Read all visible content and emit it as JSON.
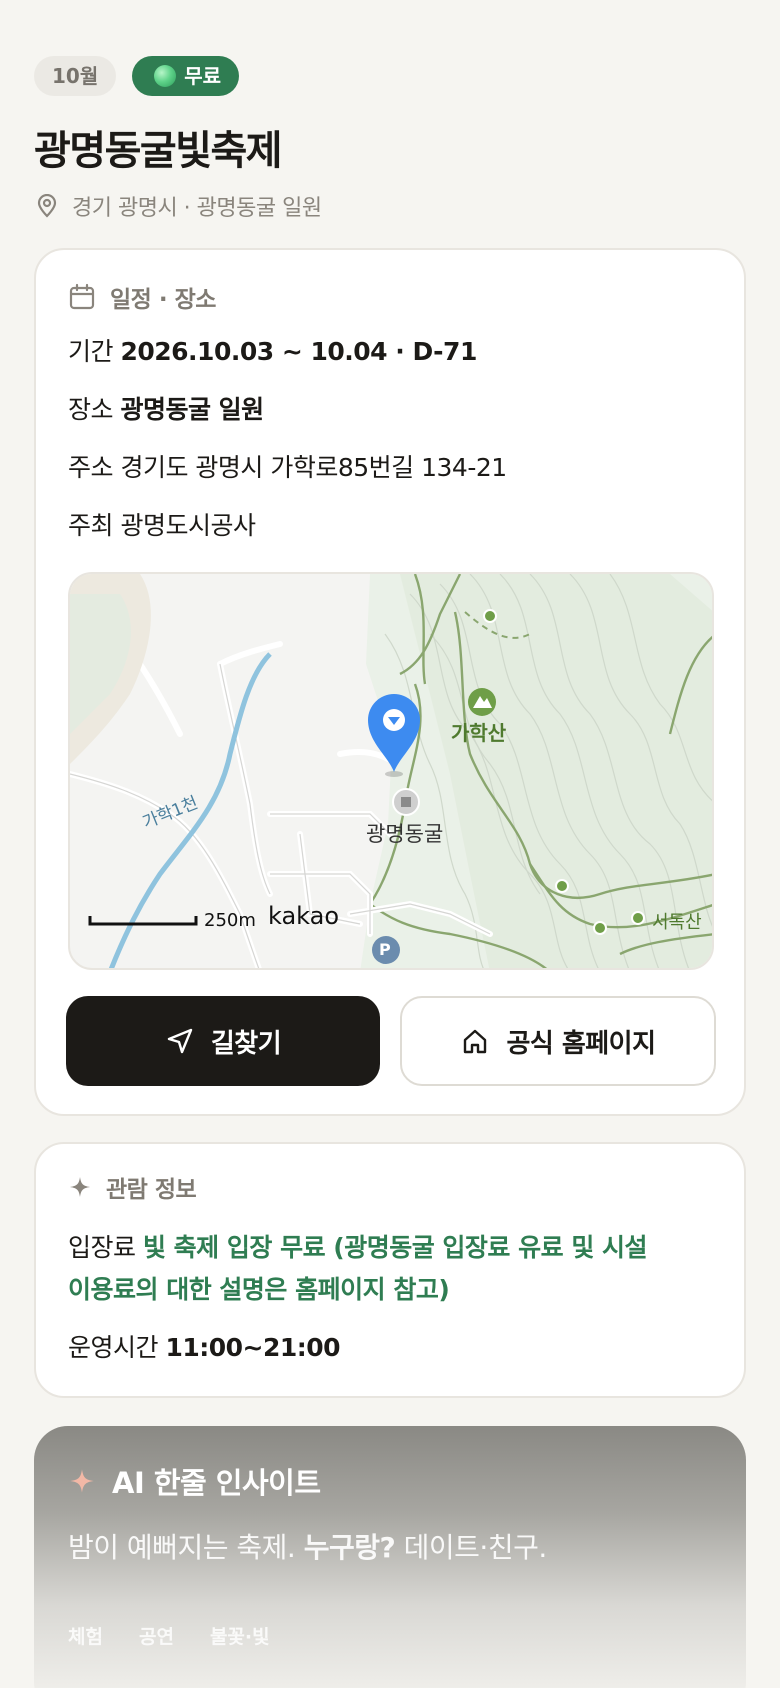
{
  "header": {
    "month_chip": "10월",
    "free_chip": "무료",
    "title": "광명동굴빛축제",
    "location": "경기 광명시 · 광명동굴 일원"
  },
  "schedule": {
    "section_title": "일정 · 장소",
    "period_label": "기간",
    "period_value": "2026.10.03 ~ 10.04 · D-71",
    "place_label": "장소",
    "place_value": "광명동굴 일원",
    "address_label": "주소",
    "address_value": "경기도 광명시 가학로85번길 134-21",
    "host_label": "주최",
    "host_value": "광명도시공사"
  },
  "map": {
    "stream_label": "가학1천",
    "mountain_label": "가학산",
    "cave_label": "광명동굴",
    "east_label": "서독산",
    "scale_label": "250m",
    "brand": "kakao",
    "parking": "P"
  },
  "buttons": {
    "directions": "길찾기",
    "homepage": "공식 홈페이지"
  },
  "visit": {
    "section_title": "관람 정보",
    "fee_label": "입장료",
    "fee_line1": "빛 축제 입장 무료 (광명동굴 입장료 유료 및 시설",
    "fee_line2": "이용료의 대한 설명은 홈페이지 참고)",
    "hours_label": "운영시간",
    "hours_value": "11:00~21:00"
  },
  "ai": {
    "title": "AI 한줄 인사이트",
    "text_before": "밤이 예뻐지는 축제.",
    "text_bold": "누구랑?",
    "text_after": "데이트·친구.",
    "tags": [
      "체험",
      "공연",
      "불꽃·빛"
    ]
  },
  "colors": {
    "accent_green": "#2f7d52",
    "dark_button": "#1c1a17",
    "background": "#f6f5f1"
  }
}
